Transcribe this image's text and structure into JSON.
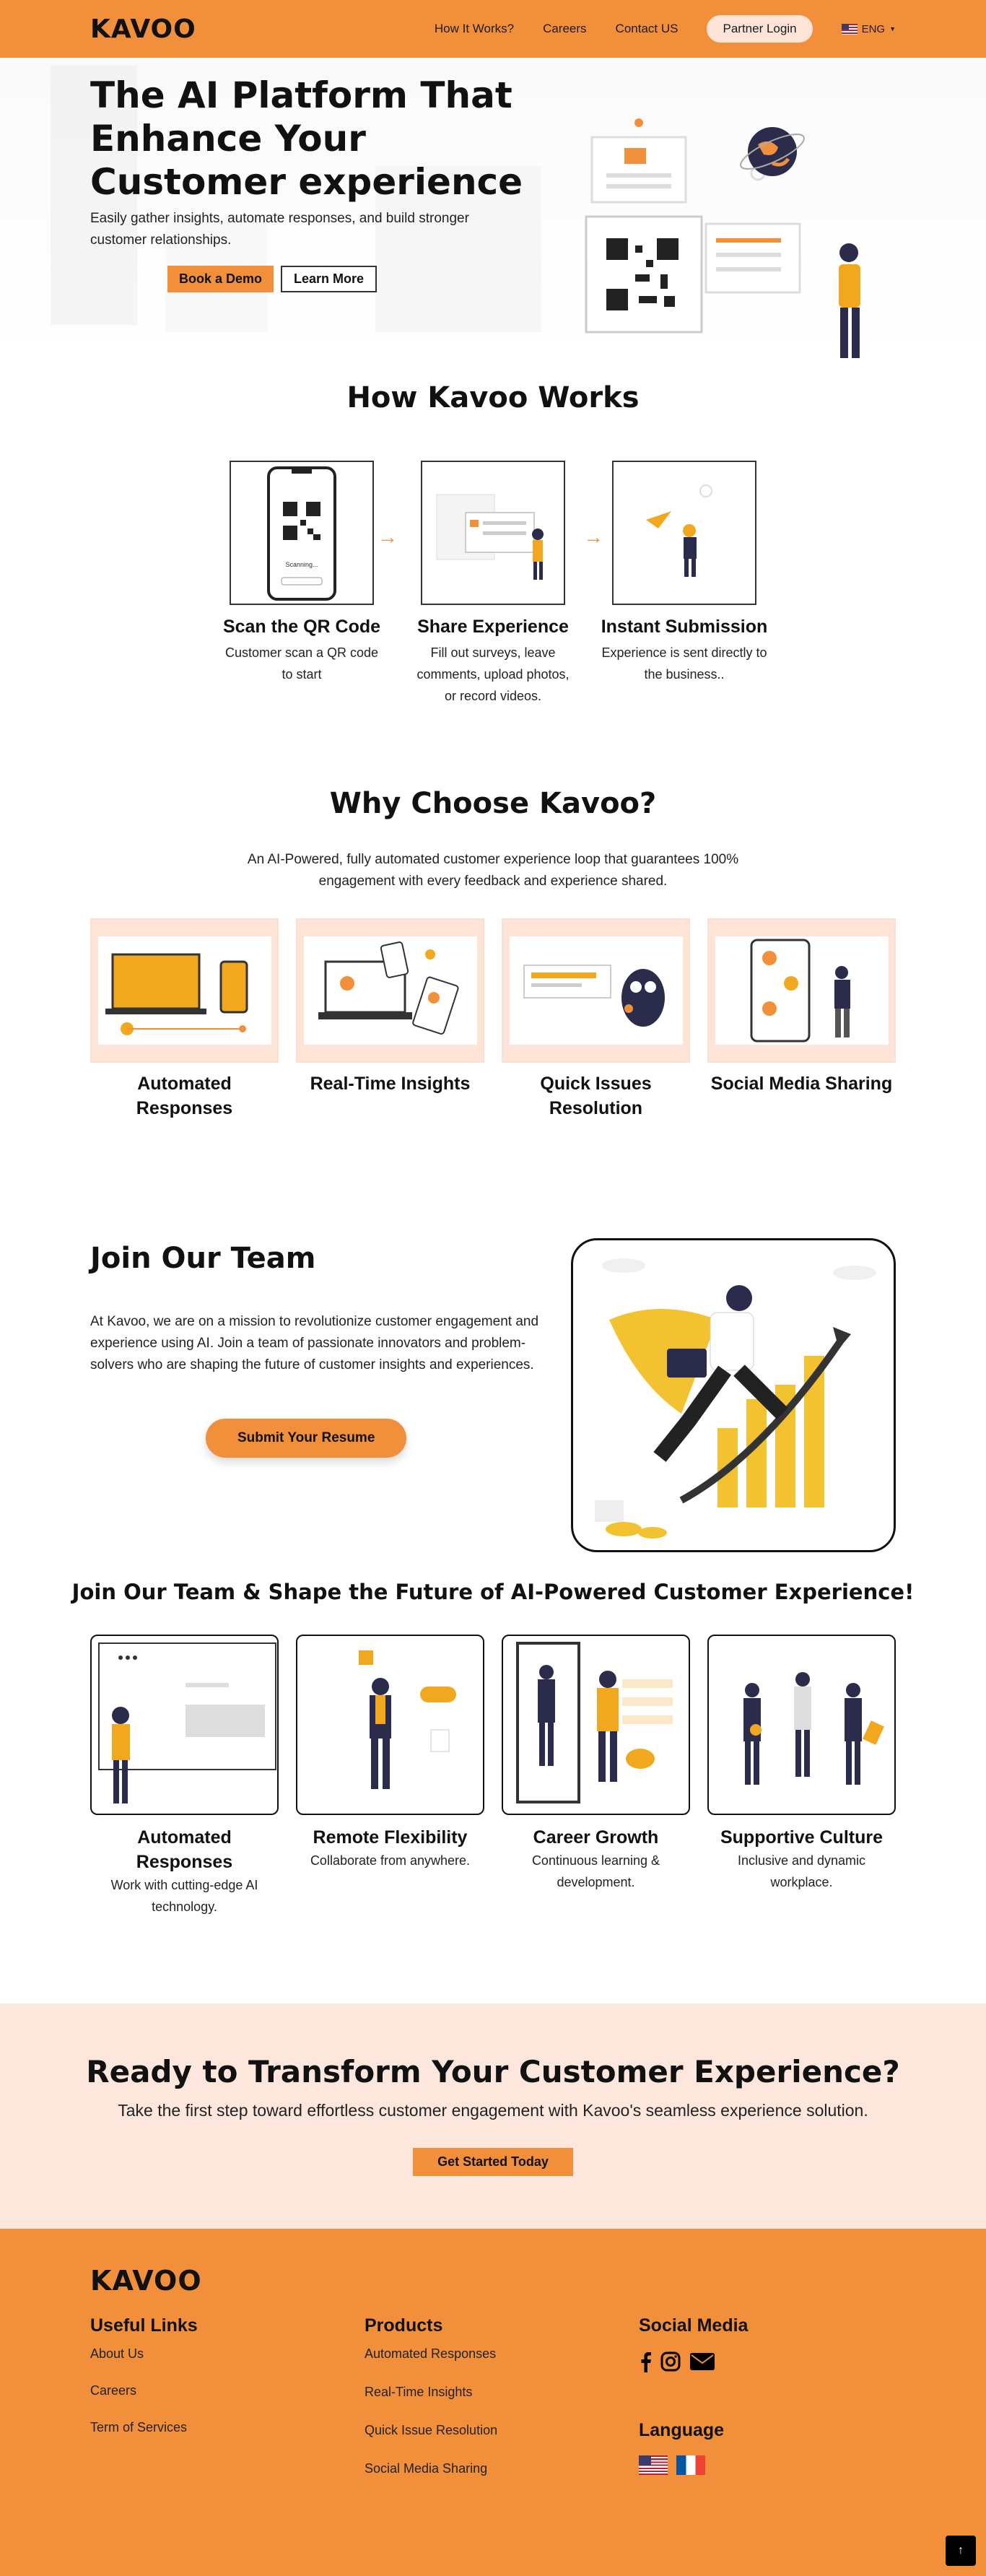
{
  "nav": {
    "logo": "KAVOO",
    "links": [
      "How It Works?",
      "Careers",
      "Contact US"
    ],
    "partner_login": "Partner Login",
    "language": "ENG"
  },
  "hero": {
    "title": "The AI Platform That Enhance Your Customer experience",
    "subtitle": "Easily gather insights, automate responses, and build stronger customer relationships.",
    "demo_button": "Book a Demo",
    "learn_button": "Learn More"
  },
  "how": {
    "title": "How Kavoo Works",
    "phone_scanning": "Scanning...",
    "steps": [
      {
        "title": "Scan the QR Code",
        "text": "Customer scan a QR code to start"
      },
      {
        "title": "Share Experience",
        "text": "Fill out surveys, leave comments, upload photos, or record videos."
      },
      {
        "title": "Instant Submission",
        "text": "Experience is sent directly to the business.."
      }
    ]
  },
  "why": {
    "title": "Why Choose Kavoo?",
    "subtitle": "An AI-Powered, fully automated customer experience loop that guarantees 100% engagement with every feedback and experience shared.",
    "cards": [
      {
        "title": "Automated Responses"
      },
      {
        "title": "Real-Time Insights"
      },
      {
        "title": "Quick Issues Resolution"
      },
      {
        "title": "Social Media Sharing"
      }
    ]
  },
  "join": {
    "title": "Join Our Team",
    "text": "At Kavoo, we are on a mission to revolutionize customer engagement and experience using AI. Join a team of passionate innovators and problem-solvers who are shaping the future of customer insights and experiences.",
    "button": "Submit Your Resume"
  },
  "shape": {
    "title": "Join Our Team & Shape the Future of AI-Powered Customer Experience!",
    "cards": [
      {
        "title": "Automated Responses",
        "text": "Work with cutting-edge AI technology."
      },
      {
        "title": "Remote Flexibility",
        "text": "Collaborate from anywhere."
      },
      {
        "title": "Career Growth",
        "text": "Continuous learning & development."
      },
      {
        "title": "Supportive Culture",
        "text": "Inclusive and dynamic workplace."
      }
    ]
  },
  "cta": {
    "title": "Ready to Transform Your Customer Experience?",
    "text": "Take the first step toward effortless customer engagement with Kavoo's seamless experience solution.",
    "button": "Get Started Today"
  },
  "footer": {
    "logo": "KAVOO",
    "useful_links": {
      "title": "Useful Links",
      "items": [
        "About Us",
        "Careers",
        "Term of Services"
      ]
    },
    "products": {
      "title": "Products",
      "items": [
        "Automated Responses",
        "Real-Time Insights",
        "Quick Issue Resolution",
        "Social Media Sharing"
      ]
    },
    "social": {
      "title": "Social Media",
      "icons": [
        "facebook-icon",
        "instagram-icon",
        "email-icon"
      ]
    },
    "language": {
      "title": "Language",
      "flags": [
        "us-flag",
        "fr-flag"
      ]
    }
  },
  "colors": {
    "accent": "#f28f3b",
    "soft": "#fde4d6",
    "dark": "#111111"
  }
}
